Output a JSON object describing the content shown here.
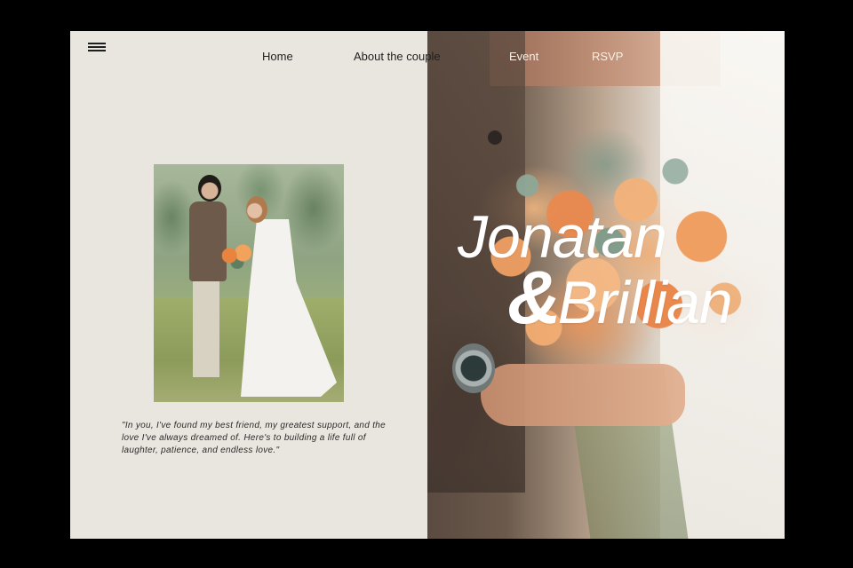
{
  "nav": {
    "home": "Home",
    "about": "About the couple",
    "event": "Event",
    "rsvp": "RSVP"
  },
  "hero": {
    "name1": "Jonatan",
    "ampersand": "&",
    "name2": "Brillian"
  },
  "quote": "\"In you, I've found my best friend, my greatest support, and the love I've always dreamed of. Here's to building a life full of laughter, patience, and endless love.\"",
  "icons": {
    "menu": "hamburger-menu-icon"
  },
  "colors": {
    "page_background": "#000000",
    "left_panel": "#e9e6e0",
    "text_dark": "#1f1f1f",
    "text_light": "#ffffff"
  }
}
